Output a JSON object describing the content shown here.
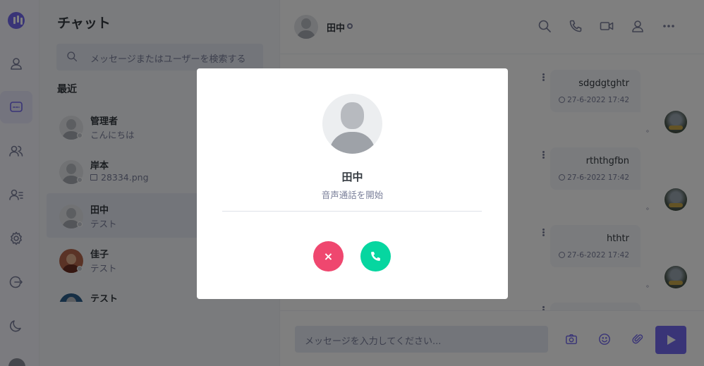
{
  "list_panel": {
    "title": "チャット",
    "search_placeholder": "メッセージまたはユーザーを検索する",
    "section_label": "最近",
    "contacts": [
      {
        "name": "管理者",
        "preview": "こんにちは"
      },
      {
        "name": "岸本",
        "preview": "28334.png",
        "preview_icon": "image-icon"
      },
      {
        "name": "田中",
        "preview": "テスト"
      },
      {
        "name": "佳子",
        "preview": "テスト"
      },
      {
        "name": "テスト",
        "preview": ""
      }
    ]
  },
  "conversation": {
    "header_name": "田中",
    "header_icons": [
      "search-icon",
      "phone-icon",
      "video-icon",
      "user-icon",
      "more-icon"
    ],
    "messages": [
      {
        "text": "sdgdgtghtr",
        "time": "27-6-2022 17:42",
        "ack": "。"
      },
      {
        "text": "rththgfbn",
        "time": "27-6-2022 17:42",
        "ack": "。"
      },
      {
        "text": "hthtr",
        "time": "27-6-2022 17:42",
        "ack": "。"
      }
    ],
    "composer_placeholder": "メッセージを入力してください...",
    "composer_icons": [
      "camera-icon",
      "emoji-icon",
      "attachment-icon",
      "send-icon"
    ]
  },
  "call_modal": {
    "name": "田中",
    "subtitle": "音声通話を開始",
    "reject_label": "×"
  },
  "colors": {
    "accent": "#7269ef",
    "reject": "#ef476f",
    "accept": "#06d6a0"
  }
}
